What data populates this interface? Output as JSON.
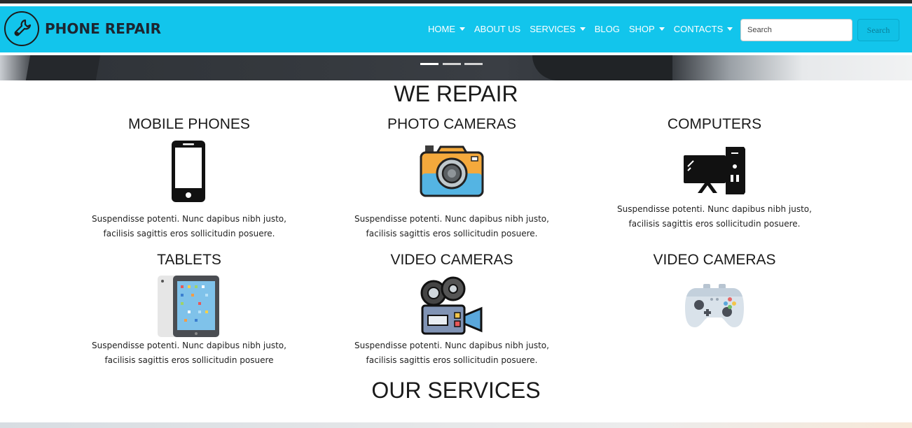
{
  "brand": {
    "name": "PHONE REPAIR"
  },
  "nav": {
    "items": [
      {
        "label": "HOME",
        "dropdown": true
      },
      {
        "label": "ABOUT US",
        "dropdown": false
      },
      {
        "label": "SERVICES",
        "dropdown": true
      },
      {
        "label": "BLOG",
        "dropdown": false
      },
      {
        "label": "SHOP",
        "dropdown": true
      },
      {
        "label": "CONTACTS",
        "dropdown": true
      }
    ],
    "search_placeholder": "Search",
    "search_button": "Search"
  },
  "carousel": {
    "slides": 3,
    "active": 1
  },
  "repair": {
    "heading": "WE REPAIR",
    "items": [
      {
        "title": "MOBILE PHONES",
        "icon": "mobile-phone-icon",
        "text_line1": "Suspendisse potenti. Nunc dapibus nibh justo,",
        "text_line2": "facilisis sagittis eros sollicitudin posuere."
      },
      {
        "title": "PHOTO CAMERAS",
        "icon": "photo-camera-icon",
        "text_line1": "Suspendisse potenti. Nunc dapibus nibh justo,",
        "text_line2": "facilisis sagittis eros sollicitudin posuere."
      },
      {
        "title": "COMPUTERS",
        "icon": "computer-icon",
        "text_line1": "Suspendisse potenti. Nunc dapibus nibh justo,",
        "text_line2": "facilisis sagittis eros sollicitudin posuere."
      },
      {
        "title": "TABLETS",
        "icon": "tablet-icon",
        "text_line1": "Suspendisse potenti. Nunc dapibus nibh justo,",
        "text_line2": "facilisis sagittis eros sollicitudin posuere"
      },
      {
        "title": "VIDEO CAMERAS",
        "icon": "video-camera-icon",
        "text_line1": "Suspendisse potenti. Nunc dapibus nibh justo,",
        "text_line2": "facilisis sagittis eros sollicitudin posuere."
      },
      {
        "title": "VIDEO CAMERAS",
        "icon": "gamepad-icon"
      }
    ]
  },
  "services": {
    "heading": "OUR SERVICES"
  },
  "colors": {
    "navbar": "#12c5ec",
    "text": "#1a1a1a"
  }
}
